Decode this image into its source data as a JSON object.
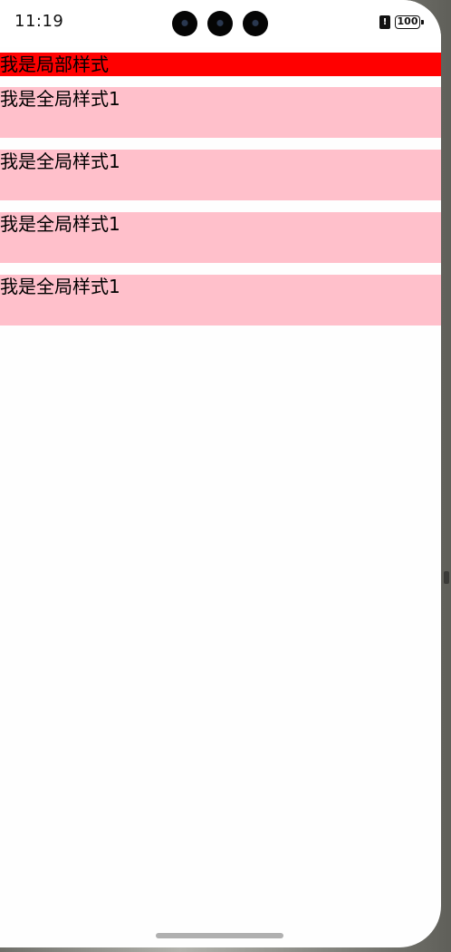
{
  "status_bar": {
    "time": "11:19",
    "alert_symbol": "!",
    "battery_level": "100"
  },
  "content": {
    "local_style_text": "我是局部样式",
    "global_style_items": [
      {
        "text": "我是全局样式1"
      },
      {
        "text": "我是全局样式1"
      },
      {
        "text": "我是全局样式1"
      },
      {
        "text": "我是全局样式1"
      }
    ]
  },
  "colors": {
    "local_style_bg": "#ff0000",
    "global_style_bg": "#ffc0cb",
    "screen_bg": "#fefefe"
  },
  "icons": [
    "camera-icon",
    "alert-icon",
    "battery-icon"
  ]
}
